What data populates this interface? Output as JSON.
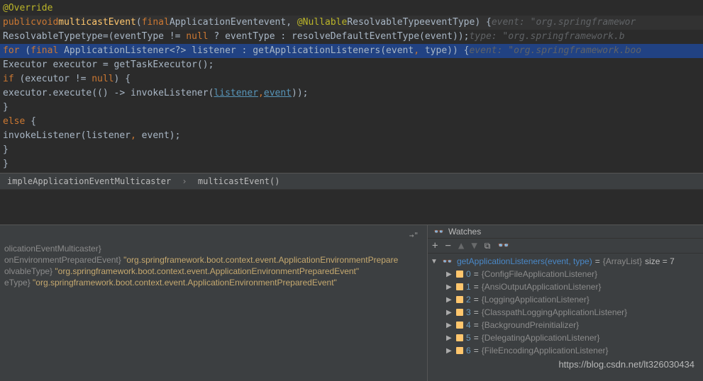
{
  "code": {
    "annotation": "@Override",
    "line_public": "public",
    "line_void": "void",
    "method_name": "multicastEvent",
    "sig_p1_final": "final",
    "sig_p1_type": "ApplicationEvent",
    "sig_p1_name": "event",
    "sig_nullable": "@Nullable",
    "sig_p2_type": "ResolvableType",
    "sig_p2_name": "eventType",
    "hint1": "event: \"org.springframewor",
    "l2_type": "ResolvableType",
    "l2_name": "type",
    "l2_eq": "=",
    "l2_paren": "(eventType != ",
    "l2_null": "null",
    "l2_tern": " ? eventType : resolveDefaultEventType(event));",
    "hint2": "type: \"org.springframework.b",
    "l3_for": "for",
    "l3_open": " (",
    "l3_final": "final",
    "l3_type": " ApplicationListener<?> listener : getApplicationListeners(event",
    "l3_comma": ",",
    "l3_rest": " type)) {",
    "hint3": "event: \"org.springframework.boo",
    "l4": "Executor executor = getTaskExecutor();",
    "l5_if": "if",
    "l5_rest": " (executor != ",
    "l5_null": "null",
    "l5_close": ") {",
    "l6_pre": "executor.execute(() -> invokeListener(",
    "l6_listener": "listener",
    "l6_comma": ",",
    "l6_event": "event",
    "l6_close": "));",
    "l7": "}",
    "l8_else": "else",
    "l8_brace": " {",
    "l9": "invokeListener(listener",
    "l9_comma": ",",
    "l9_rest": " event);",
    "l10": "}",
    "l11": "}"
  },
  "breadcrumb": {
    "class": "impleApplicationEventMulticaster",
    "method": "multicastEvent()"
  },
  "variables": {
    "line1_left": "olicationEventMulticaster}",
    "line2_left": "onEnvironmentPreparedEvent}",
    "line2_str": "\"org.springframework.boot.context.event.ApplicationEnvironmentPrepare",
    "line3_left": "olvableType}",
    "line3_str": "\"org.springframework.boot.context.event.ApplicationEnvironmentPreparedEvent\"",
    "line4_left": "eType}",
    "line4_str": "\"org.springframework.boot.context.event.ApplicationEnvironmentPreparedEvent\""
  },
  "watches": {
    "title": "Watches",
    "root_name": "getApplicationListeners(event, type)",
    "root_type": "{ArrayList}",
    "root_size_label": "size = 7",
    "items": [
      {
        "idx": "0",
        "val": "{ConfigFileApplicationListener}"
      },
      {
        "idx": "1",
        "val": "{AnsiOutputApplicationListener}"
      },
      {
        "idx": "2",
        "val": "{LoggingApplicationListener}"
      },
      {
        "idx": "3",
        "val": "{ClasspathLoggingApplicationListener}"
      },
      {
        "idx": "4",
        "val": "{BackgroundPreinitializer}"
      },
      {
        "idx": "5",
        "val": "{DelegatingApplicationListener}"
      },
      {
        "idx": "6",
        "val": "{FileEncodingApplicationListener}"
      }
    ]
  },
  "watermark": "https://blog.csdn.net/lt326030434"
}
